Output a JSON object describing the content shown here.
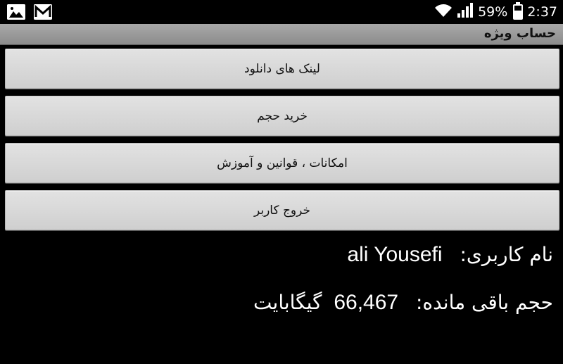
{
  "status_bar": {
    "icons_left": [
      "image-icon",
      "gmail-icon"
    ],
    "battery_percent": "59%",
    "battery_level": 0.59,
    "time": "2:37",
    "icons_right": [
      "wifi-icon",
      "signal-icon",
      "battery-icon"
    ]
  },
  "title_bar": {
    "title": "حساب ویژه"
  },
  "menu": {
    "buttons": [
      {
        "label": "لینک های دانلود"
      },
      {
        "label": "خرید حجم"
      },
      {
        "label": "امکانات ، قوانین و آموزش"
      },
      {
        "label": "خروج کاربر"
      }
    ]
  },
  "account": {
    "username_label": "نام کاربری:",
    "username_value": "ali Yousefi",
    "remaining_label": "حجم باقی مانده:",
    "remaining_value": "66,467",
    "remaining_unit": "گیگابایت"
  }
}
